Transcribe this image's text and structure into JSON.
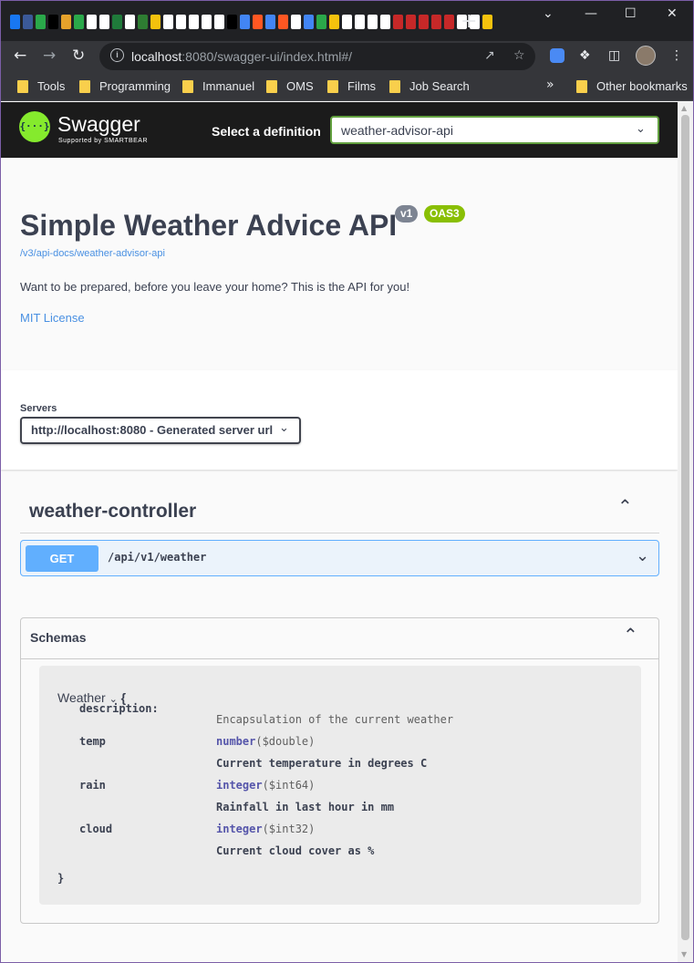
{
  "browser": {
    "new_tab": "+",
    "url_host": "localhost",
    "url_rest": ":8080/swagger-ui/index.html#/",
    "bookmarks": [
      "Tools",
      "Programming",
      "Immanuel",
      "OMS",
      "Films",
      "Job Search"
    ],
    "other_bookmarks": "Other bookmarks",
    "tab_icon_colors": [
      "#1877f2",
      "#3b5998",
      "#2aa84a",
      "#000000",
      "#e5a22b",
      "#2aa84a",
      "#ffffff",
      "#ffffff",
      "#1f7a3a",
      "#ffffff",
      "#2e7d32",
      "#f4c20d",
      "#ffffff",
      "#ffffff",
      "#ffffff",
      "#ffffff",
      "#ffffff",
      "#000000",
      "#4285f4",
      "#ff5722",
      "#4285f4",
      "#ff5722",
      "#ffffff",
      "#4285f4",
      "#2aa84a",
      "#f4c20d",
      "#ffffff",
      "#ffffff",
      "#ffffff",
      "#ffffff",
      "#c62828",
      "#c62828",
      "#c62828",
      "#c62828",
      "#c62828",
      "#ffffff",
      "#ffffff",
      "#f4c20d"
    ]
  },
  "swagger": {
    "brand": "Swagger",
    "logo_glyph": "{···}",
    "brand_sub": "Supported by SMARTBEAR",
    "select_definition_label": "Select a definition",
    "selected_definition": "weather-advisor-api"
  },
  "info": {
    "title": "Simple Weather Advice API",
    "version_badge": "v1",
    "oas_badge": "OAS3",
    "docs_link": "/v3/api-docs/weather-advisor-api",
    "description": "Want to be prepared, before you leave your home? This is the API for you!",
    "license": "MIT License"
  },
  "servers": {
    "label": "Servers",
    "selected": "http://localhost:8080 - Generated server url"
  },
  "controller": {
    "name": "weather-controller",
    "operations": [
      {
        "method": "GET",
        "path": "/api/v1/weather"
      }
    ]
  },
  "schemas": {
    "title": "Schemas",
    "model": {
      "name": "Weather",
      "open_brace": "{",
      "close_brace": "}",
      "description_key": "description:",
      "description": "Encapsulation of the current weather",
      "properties": [
        {
          "name": "temp",
          "type": "number",
          "format": "($double)",
          "description": "Current temperature in degrees C"
        },
        {
          "name": "rain",
          "type": "integer",
          "format": "($int64)",
          "description": "Rainfall in last hour in mm"
        },
        {
          "name": "cloud",
          "type": "integer",
          "format": "($int32)",
          "description": "Current cloud cover as %"
        }
      ]
    }
  },
  "colors": {
    "get_method": "#61affe",
    "swagger_green": "#85ea2d",
    "badge_grey": "#7d8492",
    "badge_green": "#89bf04",
    "link_blue": "#4990e2"
  }
}
